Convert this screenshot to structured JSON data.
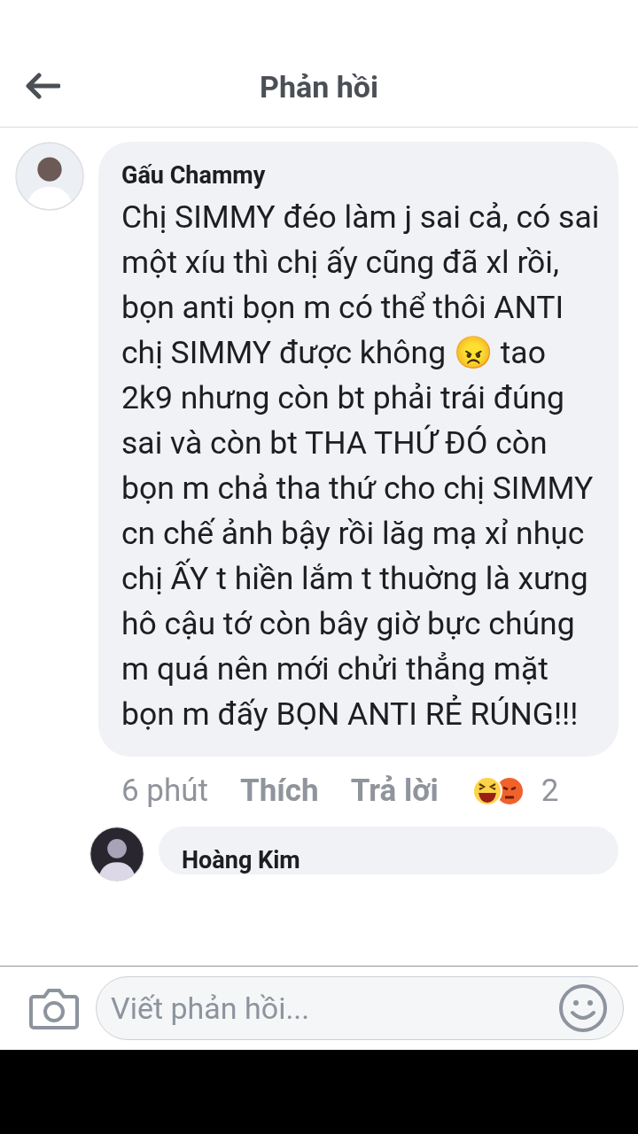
{
  "header": {
    "title": "Phản hồi"
  },
  "comments": [
    {
      "author": "Gấu Chammy",
      "text": "Chị SIMMY đéo làm j sai cả, có sai một xíu thì chị ấy cũng đã xl rồi, bọn anti bọn m có thể thôi ANTI chị SIMMY được không 😠 tao 2k9 nhưng còn bt phải trái đúng sai và còn bt THA THỨ ĐÓ còn bọn m chả tha thứ cho chị SIMMY cn chế ảnh bậy rồi lăg mạ xỉ nhục chị ẤY t hiền lắm t thuờng là xưng hô cậu tớ còn bây giờ bực chúng m quá nên mới chửi thẳng mặt bọn m đấy BỌN ANTI RẺ RÚNG!!!",
      "time": "6 phút",
      "like": "Thích",
      "reply": "Trả lời",
      "reaction_count": "2"
    },
    {
      "author": "Hoàng Kim"
    }
  ],
  "composer": {
    "placeholder": "Viết phản hồi..."
  }
}
